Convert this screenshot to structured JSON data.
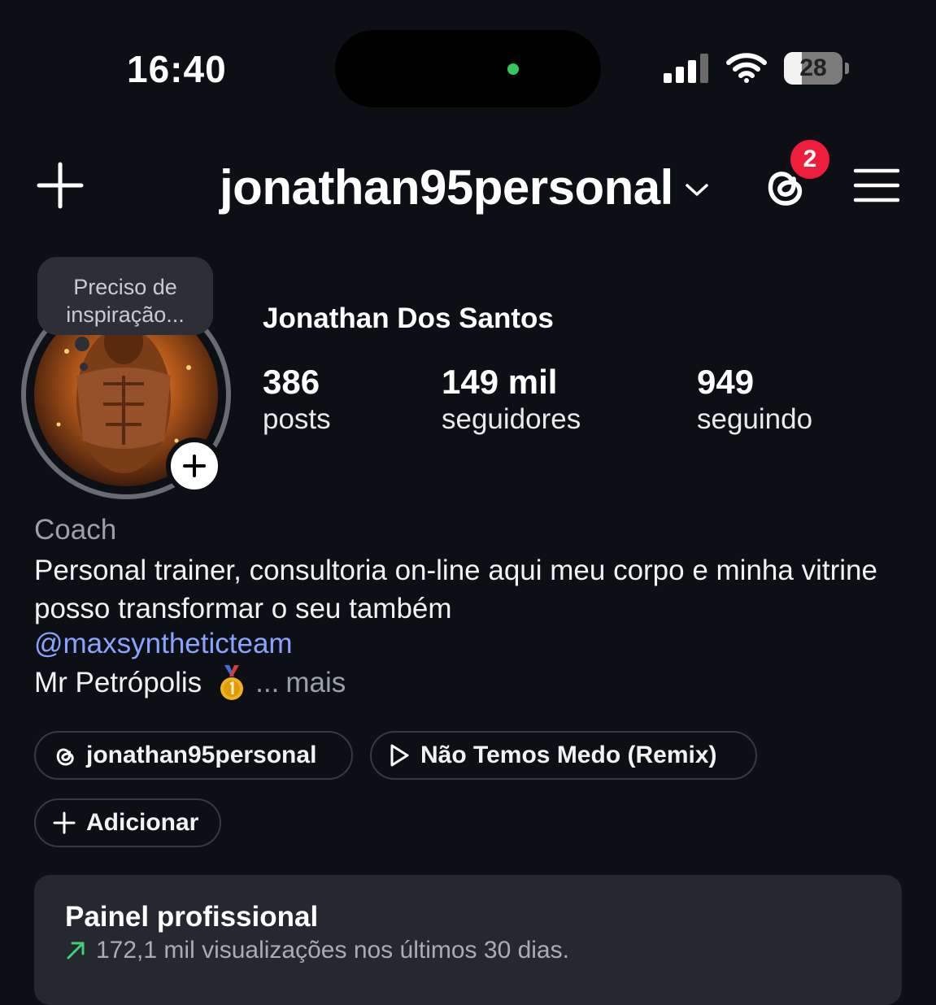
{
  "status_bar": {
    "time": "16:40",
    "battery": "28",
    "indicator_color": "#34c759"
  },
  "header": {
    "username": "jonathan95personal",
    "threads_badge": "2"
  },
  "profile": {
    "note": "Preciso de inspiração...",
    "full_name": "Jonathan Dos Santos",
    "stats": [
      {
        "value": "386",
        "label": "posts"
      },
      {
        "value": "149 mil",
        "label": "seguidores"
      },
      {
        "value": "949",
        "label": "seguindo"
      }
    ],
    "category": "Coach",
    "bio_text": "Personal trainer, consultoria on-line aqui meu corpo e minha vitrine posso transformar o seu também",
    "mention": "@maxsyntheticteam",
    "bio_last": "Mr Petrópolis",
    "ellipsis": "...",
    "more": "mais"
  },
  "chips": {
    "threads_label": "jonathan95personal",
    "music_label": "Não Temos Medo (Remix)",
    "add_label": "Adicionar"
  },
  "dashboard": {
    "title": "Painel profissional",
    "subtitle": "172,1 mil visualizações nos últimos 30 dias."
  },
  "colors": {
    "background": "#0c0f14",
    "mention": "#8aa3ff",
    "badge": "#ee1d3c",
    "trend_arrow": "#3fd07a"
  }
}
